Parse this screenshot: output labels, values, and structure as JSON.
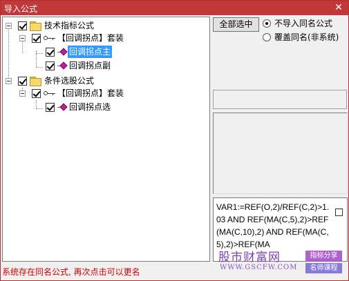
{
  "window": {
    "title": "导入公式",
    "close_glyph": "✕"
  },
  "tree": {
    "group1": {
      "label": "技术指标公式",
      "suite": {
        "label": "【回调拐点】套装",
        "items": [
          {
            "label": "回调拐点主",
            "selected": true
          },
          {
            "label": "回调拐点副",
            "selected": false
          }
        ]
      }
    },
    "group2": {
      "label": "条件选股公式",
      "suite": {
        "label": "【回调拐点】套装",
        "items": [
          {
            "label": "回调拐点选",
            "selected": false
          }
        ]
      }
    }
  },
  "options": {
    "select_all_label": "全部选中",
    "radio_no_import": "不导入同名公式",
    "radio_overwrite": "覆盖同名(非系统)",
    "selected_radio": "radio_no_import"
  },
  "formula_text": "VAR1:=REF(O,2)/REF(C,2)>1.03 AND REF(MA(C,5),2)>REF(MA(C,10),2) AND REF(MA(C,5),2)>REF(MA",
  "watermark": {
    "title": "股市财富网",
    "url": "WWW.GSCFW.COM",
    "tag1": "指标分享",
    "tag2": "名师课程"
  },
  "status_text": "系统存在同名公式, 再次点击可以更名",
  "colors": {
    "titlebar": "#c0383a",
    "status": "#d00000",
    "selection": "#3399ff"
  }
}
